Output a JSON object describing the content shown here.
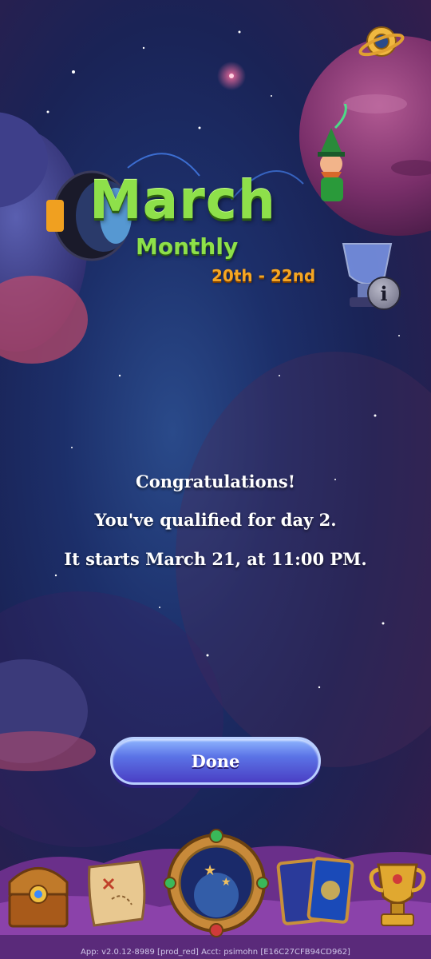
{
  "event": {
    "title": "March",
    "subtitle": "Monthly",
    "dates": "20th - 22nd"
  },
  "message": {
    "line1": "Congratulations!",
    "line2": "You've qualified for day 2.",
    "line3": "It starts March 21, at 11:00 PM."
  },
  "done_button": {
    "label": "Done"
  },
  "info_button": {
    "label": "i"
  },
  "bottom_nav": {
    "items": [
      "treasure-chest-icon",
      "treasure-map-icon",
      "portal-icon",
      "cards-icon",
      "trophy-icon"
    ]
  },
  "footer": {
    "text": "App: v2.0.12-8989 [prod_red] Acct: psimohn [E16C27CFB94CD962]"
  },
  "colors": {
    "title_green": "#8ee04a",
    "dates_orange": "#f5a623",
    "button_blue": "#5b73e6"
  }
}
